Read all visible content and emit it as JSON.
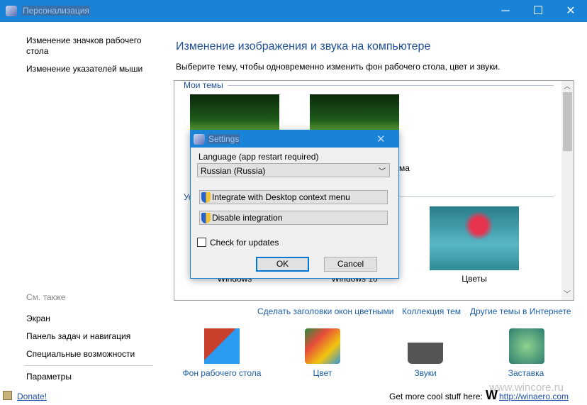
{
  "window": {
    "title": "Персонализация",
    "minimize": "─",
    "maximize": "☐",
    "close": "✕"
  },
  "sidebar": {
    "tasks": [
      "Изменение значков рабочего стола",
      "Изменение указателей мыши"
    ],
    "see_also_label": "См. также",
    "see_also": [
      "Экран",
      "Панель задач и навигация",
      "Специальные возможности"
    ],
    "settings": "Параметры"
  },
  "main": {
    "heading": "Изменение изображения и звука на компьютере",
    "subtitle": "Выберите тему, чтобы одновременно изменить фон рабочего стола, цвет и звуки.",
    "my_themes_label": "Мои темы",
    "my_theme_label_fragment": "ма",
    "installed_label_fragment": "Ус",
    "installed_themes": [
      "Windows",
      "Windows 10",
      "Цветы"
    ],
    "links": [
      "Сделать заголовки окон цветными",
      "Коллекция тем",
      "Другие темы в Интернете"
    ],
    "options": [
      {
        "label": "Фон рабочего стола",
        "icon": "desktop-background-icon"
      },
      {
        "label": "Цвет",
        "icon": "color-icon"
      },
      {
        "label": "Звуки",
        "icon": "sounds-icon"
      },
      {
        "label": "Заставка",
        "icon": "screensaver-icon"
      }
    ]
  },
  "footer": {
    "donate": "Donate!",
    "more": "Get more cool stuff here:",
    "logo": "W",
    "url": "http://winaero.com",
    "watermark": "www.wincore.ru"
  },
  "dialog": {
    "title": "Settings",
    "close": "✕",
    "language_label": "Language (app restart required)",
    "language_value": "Russian (Russia)",
    "integrate": "Integrate with Desktop context menu",
    "disable": "Disable integration",
    "check_updates": "Check for updates",
    "check_updates_checked": false,
    "ok": "OK",
    "cancel": "Cancel"
  },
  "colors": {
    "titlebar": "#1883d7",
    "link": "#1c5fa8",
    "heading": "#1e4f96"
  }
}
